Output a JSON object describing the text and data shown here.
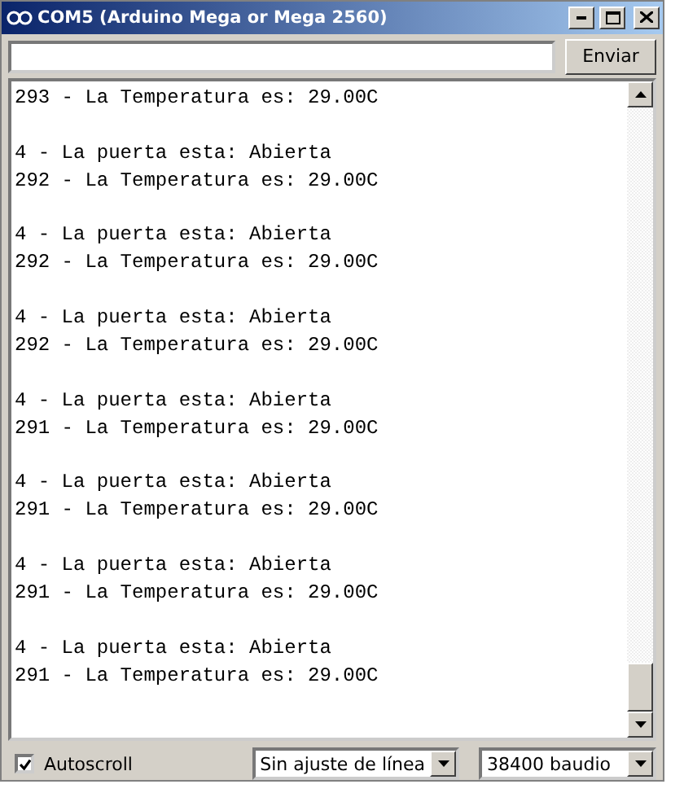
{
  "window": {
    "title": "COM5 (Arduino Mega or Mega 2560)"
  },
  "send_button": "Enviar",
  "output_blocks": [
    {
      "lines": [
        "293 - La Temperatura es: 29.00C"
      ]
    },
    {
      "lines": [
        "4 - La puerta esta: Abierta",
        "292 - La Temperatura es: 29.00C"
      ]
    },
    {
      "lines": [
        "4 - La puerta esta: Abierta",
        "292 - La Temperatura es: 29.00C"
      ]
    },
    {
      "lines": [
        "4 - La puerta esta: Abierta",
        "292 - La Temperatura es: 29.00C"
      ]
    },
    {
      "lines": [
        "4 - La puerta esta: Abierta",
        "291 - La Temperatura es: 29.00C"
      ]
    },
    {
      "lines": [
        "4 - La puerta esta: Abierta",
        "291 - La Temperatura es: 29.00C"
      ]
    },
    {
      "lines": [
        "4 - La puerta esta: Abierta",
        "291 - La Temperatura es: 29.00C"
      ]
    },
    {
      "lines": [
        "4 - La puerta esta: Abierta",
        "291 - La Temperatura es: 29.00C"
      ]
    }
  ],
  "autoscroll": {
    "label": "Autoscroll",
    "checked": true
  },
  "line_ending": {
    "value": "Sin ajuste de línea"
  },
  "baud_rate": {
    "value": "38400 baudio"
  }
}
